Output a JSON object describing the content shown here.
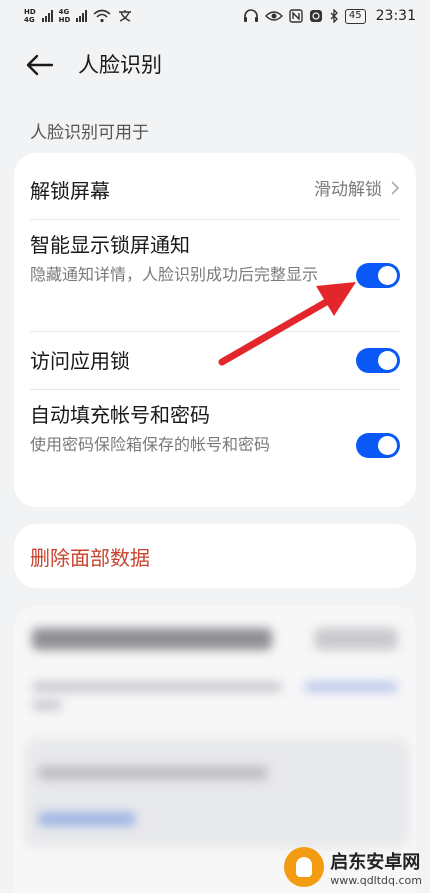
{
  "status_bar": {
    "left_labels": [
      "HD",
      "4G",
      "4G",
      "HD"
    ],
    "battery": "45",
    "time": "23:31"
  },
  "header": {
    "title": "人脸识别"
  },
  "section": {
    "title": "人脸识别可用于"
  },
  "settings": {
    "unlock": {
      "label": "解锁屏幕",
      "value": "滑动解锁"
    },
    "smart_notify": {
      "label": "智能显示锁屏通知",
      "desc": "隐藏通知详情，人脸识别成功后完整显示",
      "enabled": true
    },
    "app_lock": {
      "label": "访问应用锁",
      "enabled": true
    },
    "autofill": {
      "label": "自动填充帐号和密码",
      "desc": "使用密码保险箱保存的帐号和密码",
      "enabled": true
    }
  },
  "delete": {
    "label": "删除面部数据"
  },
  "watermark": {
    "name": "启东安卓网",
    "url": "www.qdltdq.com"
  },
  "colors": {
    "accent": "#0a59f7",
    "danger": "#c8432e",
    "arrow": "#e3262c"
  }
}
